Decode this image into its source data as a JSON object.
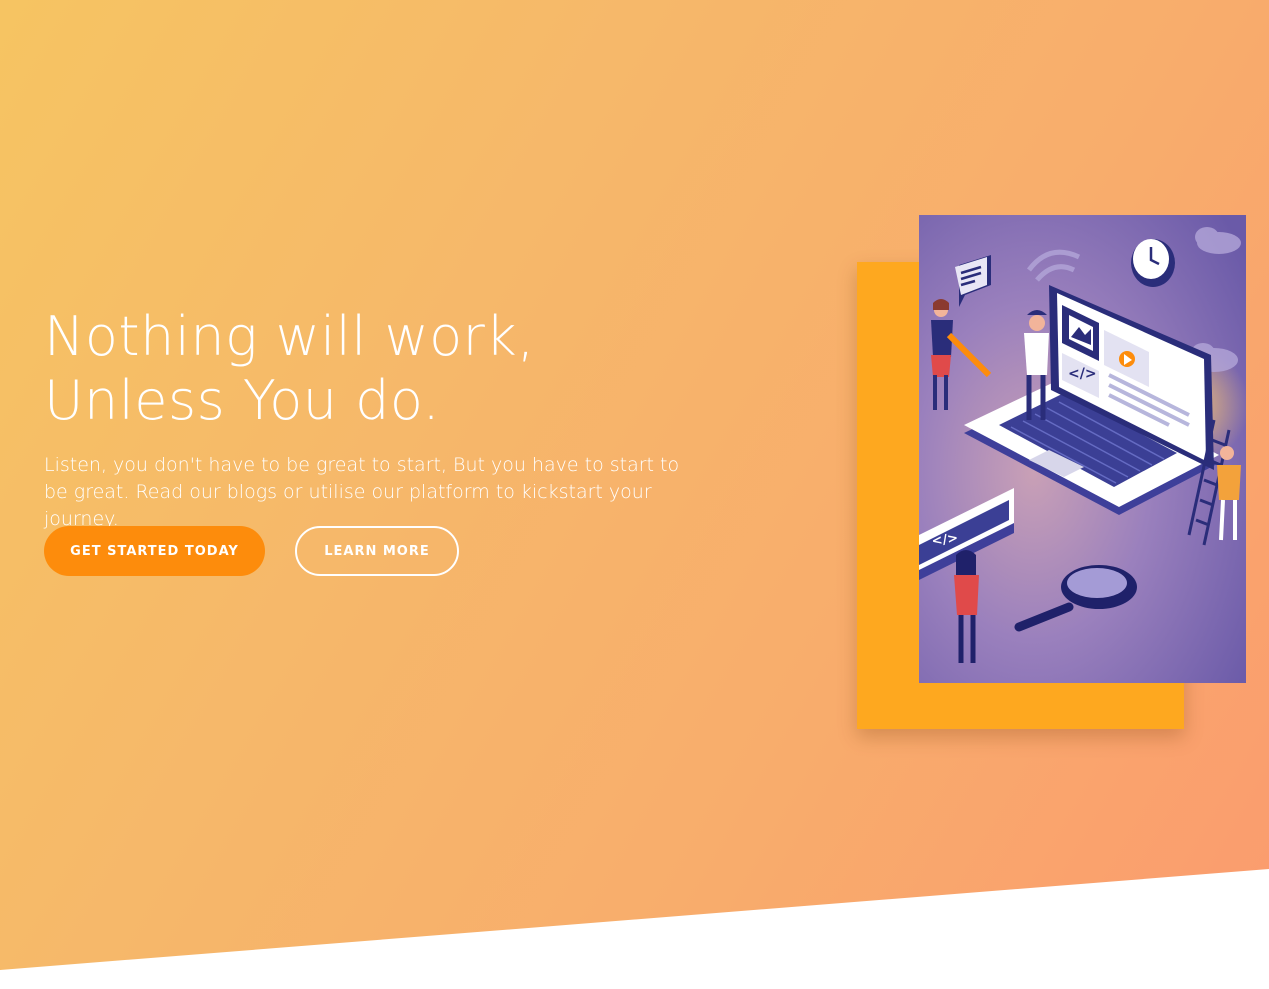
{
  "hero": {
    "headline_line1": "Nothing will work,",
    "headline_line2": "Unless You do.",
    "lede": "Listen, you don't have to be great to start, But you have to start to be great. Read our blogs or utilise our platform to kickstart your journey.",
    "primary_cta": "GET STARTED TODAY",
    "secondary_cta": "LEARN MORE"
  },
  "colors": {
    "gradient_start": "#f6c462",
    "gradient_end": "#fb9b6e",
    "primary_button": "#fd8c0c",
    "card_backdrop": "#fea81f",
    "illustration_bg": "#7f6fb5"
  },
  "illustration": {
    "semantic": "isometric-laptop-team-illustration",
    "code_label": "</>"
  }
}
